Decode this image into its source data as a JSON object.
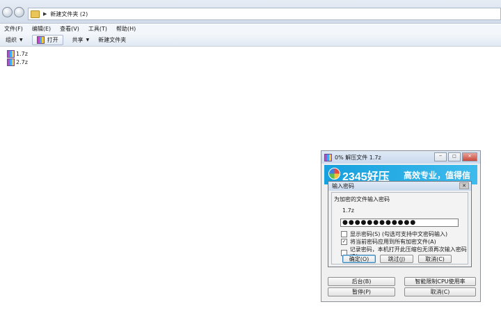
{
  "explorer": {
    "path_folder": "新建文件夹 (2)",
    "menu": [
      "文件(F)",
      "编辑(E)",
      "查看(V)",
      "工具(T)",
      "帮助(H)"
    ],
    "toolbar": {
      "organize": "组织",
      "open": "打开",
      "share": "共享",
      "new_folder": "新建文件夹"
    },
    "files": [
      "1.7z",
      "2.7z"
    ]
  },
  "extract_window": {
    "title": "0% 解压文件 1.7z",
    "brand": "2345好压",
    "slogan": "高效专业，值得信赖",
    "buttons": {
      "background": "后台(B)",
      "cpu_limit": "智能限制CPU使用率",
      "pause": "暂停(P)",
      "cancel": "取消(C)"
    }
  },
  "password_dialog": {
    "title": "输入密码",
    "prompt": "为加密的文件输入密码",
    "filename": "1.7z",
    "password_masked": "●●●●●●●●●●●●",
    "options": [
      {
        "label": "显示密码(S) (勾选可支持中文密码输入)",
        "checked": false
      },
      {
        "label": "将当前密码应用到所有加密文件(A)",
        "checked": true
      },
      {
        "label": "记录密码，本机打开此压缩包无须再次输入密码(R)",
        "checked": false
      }
    ],
    "buttons": {
      "ok": "确定(O)",
      "skip": "跳过(J)",
      "cancel": "取消(C)"
    }
  }
}
